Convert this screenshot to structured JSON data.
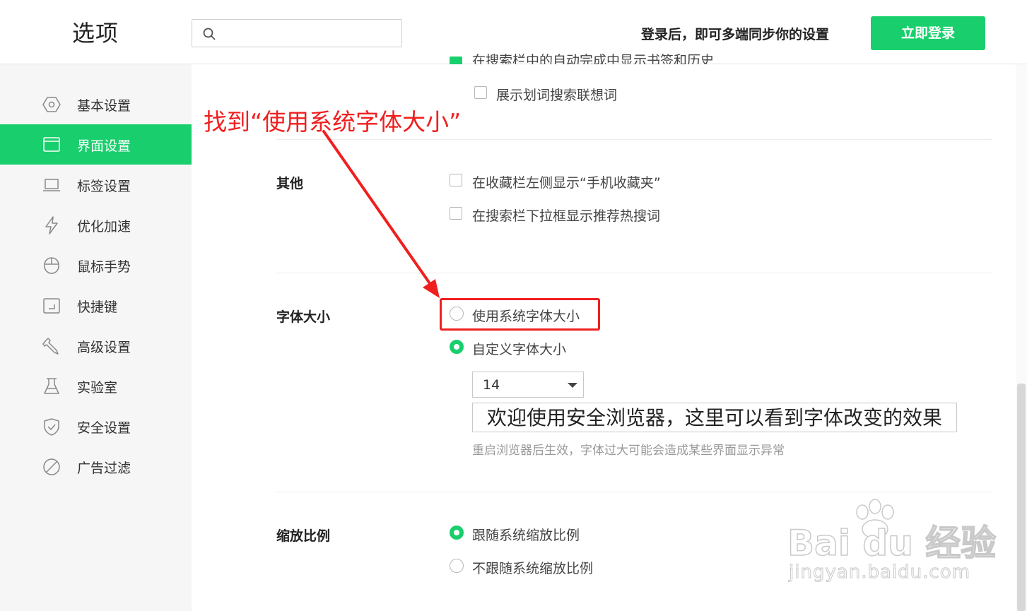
{
  "header": {
    "title": "选项",
    "search_placeholder": "",
    "sync_text": "登录后，即可多端同步你的设置",
    "login_label": "立即登录"
  },
  "sidebar": {
    "items": [
      {
        "label": "基本设置",
        "icon": "gear-icon"
      },
      {
        "label": "界面设置",
        "icon": "window-icon",
        "active": true
      },
      {
        "label": "标签设置",
        "icon": "tab-icon"
      },
      {
        "label": "优化加速",
        "icon": "lightning-icon"
      },
      {
        "label": "鼠标手势",
        "icon": "mouse-icon"
      },
      {
        "label": "快捷键",
        "icon": "keyboard-icon"
      },
      {
        "label": "高级设置",
        "icon": "wrench-icon"
      },
      {
        "label": "实验室",
        "icon": "flask-icon"
      },
      {
        "label": "安全设置",
        "icon": "shield-icon"
      },
      {
        "label": "广告过滤",
        "icon": "ban-icon"
      }
    ]
  },
  "main": {
    "cut_option_label": "在搜索栏中的自动完成中显示书签和历史",
    "suggest_words_label": "展示划词搜索联想词",
    "other": {
      "label": "其他",
      "options": [
        "在收藏栏左侧显示“手机收藏夹”",
        "在搜索栏下拉框显示推荐热搜词"
      ]
    },
    "font_size": {
      "label": "字体大小",
      "system_option": "使用系统字体大小",
      "custom_option": "自定义字体大小",
      "selected_size": "14",
      "preview_text": "欢迎使用安全浏览器，这里可以看到字体改变的效果",
      "hint": "重启浏览器后生效，字体过大可能会造成某些界面显示异常"
    },
    "zoom": {
      "label": "缩放比例",
      "follow_option": "跟随系统缩放比例",
      "nofollow_option": "不跟随系统缩放比例"
    }
  },
  "annotation": {
    "text": "找到“使用系统字体大小”"
  },
  "watermark": {
    "brand": "Bai du 经验",
    "url": "jingyan.baidu.com"
  },
  "colors": {
    "accent": "#19cf6d",
    "annotation": "#f01f1f"
  }
}
